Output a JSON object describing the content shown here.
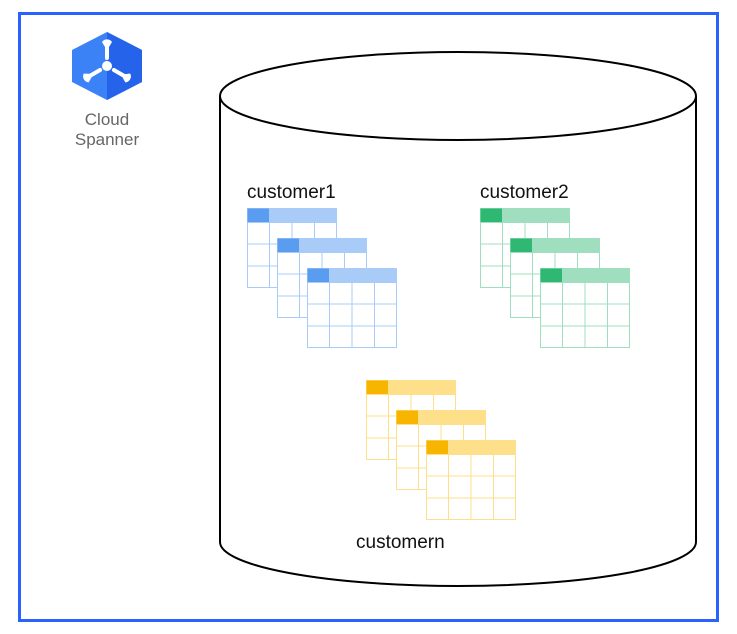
{
  "logo": {
    "line1": "Cloud",
    "line2": "Spanner",
    "icon_name": "cloud-spanner-icon"
  },
  "groups": {
    "g1": {
      "label": "customer1",
      "color": "blue"
    },
    "g2": {
      "label": "customer2",
      "color": "green"
    },
    "g3": {
      "label": "customern",
      "color": "yellow"
    }
  }
}
